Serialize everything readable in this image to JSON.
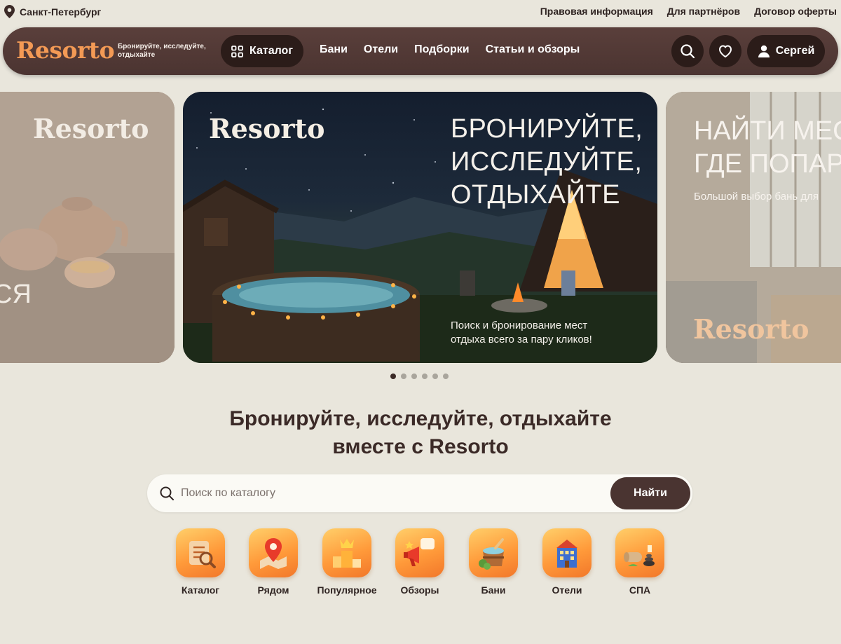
{
  "location": {
    "city": "Санкт-Петербург",
    "icon": "map-pin-icon"
  },
  "top_links": [
    "Правовая информация",
    "Для партнёров",
    "Договор оферты"
  ],
  "header": {
    "logo": "Resorto",
    "tagline": "Бронируйте, исследуйте, отдыхайте",
    "catalog_label": "Каталог",
    "nav": [
      "Бани",
      "Отели",
      "Подборки",
      "Статьи и обзоры"
    ],
    "user_name": "Сергей",
    "colors": {
      "bar": "#4f3734",
      "button": "#2b1c19",
      "logo": "#f39a55"
    }
  },
  "carousel": {
    "left": {
      "logo": "Resorto",
      "text": "СЯ"
    },
    "center": {
      "logo": "Resorto",
      "headline": "БРОНИРУЙТЕ, ИССЛЕДУЙТЕ, ОТДЫХАЙТЕ",
      "subtitle": "Поиск и бронирование мест отдыха всего за пару кликов!"
    },
    "right": {
      "logo": "Resorto",
      "headline_1": "НАЙТИ МЕС",
      "headline_2": "ГДЕ ПОПАР",
      "subtitle": "Большой выбор бань для"
    },
    "dots_count": 6,
    "active_dot": 0
  },
  "hero": {
    "title_line1": "Бронируйте, исследуйте, отдыхайте",
    "title_line2": "вместе с Resorto"
  },
  "search": {
    "placeholder": "Поиск по каталогу",
    "value": "",
    "button": "Найти"
  },
  "categories": [
    {
      "label": "Каталог",
      "icon": "catalog-notepad-icon"
    },
    {
      "label": "Рядом",
      "icon": "map-pin-icon"
    },
    {
      "label": "Популярное",
      "icon": "podium-crown-icon"
    },
    {
      "label": "Обзоры",
      "icon": "megaphone-icon"
    },
    {
      "label": "Бани",
      "icon": "bath-tub-icon"
    },
    {
      "label": "Отели",
      "icon": "hotel-building-icon"
    },
    {
      "label": "СПА",
      "icon": "spa-stones-icon"
    }
  ]
}
